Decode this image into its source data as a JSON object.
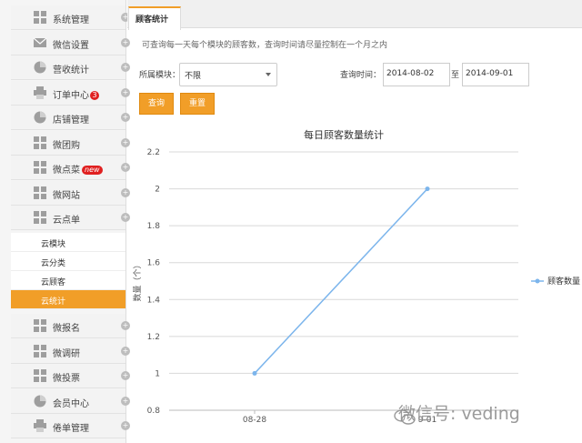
{
  "sidebar": {
    "items": [
      {
        "label": "系统管理",
        "icon": "grid-icon"
      },
      {
        "label": "微信设置",
        "icon": "envelope-icon"
      },
      {
        "label": "营收统计",
        "icon": "pie-icon"
      },
      {
        "label": "订单中心",
        "icon": "printer-icon",
        "badge": "3"
      },
      {
        "label": "店铺管理",
        "icon": "pie-icon"
      },
      {
        "label": "微团购",
        "icon": "grid-icon"
      },
      {
        "label": "微点菜",
        "icon": "grid-icon",
        "badge_new": "new"
      },
      {
        "label": "微网站",
        "icon": "grid-icon"
      },
      {
        "label": "云点单",
        "icon": "grid-icon"
      }
    ],
    "subitems": [
      "云模块",
      "云分类",
      "云顾客",
      "云统计"
    ],
    "items_bottom": [
      {
        "label": "微报名",
        "icon": "grid-icon"
      },
      {
        "label": "微调研",
        "icon": "grid-icon"
      },
      {
        "label": "微投票",
        "icon": "grid-icon"
      },
      {
        "label": "会员中心",
        "icon": "pie-icon"
      },
      {
        "label": "倦单管理",
        "icon": "printer-icon"
      }
    ],
    "expand_glyph": "+"
  },
  "tab": {
    "label": "顾客统计"
  },
  "hint": "可查询每一天每个模块的顾客数，查询时间请尽量控制在一个月之内",
  "filter": {
    "module_label": "所属模块：",
    "module_value": "不限",
    "time_label": "查询时间：",
    "date_from": "2014-08-02",
    "to_label": "至",
    "date_to": "2014-09-01",
    "query_button": "查询",
    "reset_button": "重置"
  },
  "chart_data": {
    "type": "line",
    "title": "每日顾客数量统计",
    "ylabel": "数量（个）",
    "xlabel": "",
    "categories": [
      "08-28",
      "9-01"
    ],
    "series": [
      {
        "name": "顾客数量",
        "values": [
          1,
          2
        ],
        "color": "#7cb5ec"
      }
    ],
    "ylim": [
      0.8,
      2.2
    ],
    "yticks": [
      "0.8",
      "1",
      "1.2",
      "1.4",
      "1.6",
      "1.8",
      "2",
      "2.2"
    ],
    "grid": true,
    "legend": "right"
  },
  "watermark": "微信号: veding",
  "colors": {
    "accent": "#f19e28",
    "series": "#7cb5ec",
    "badge": "#e02020"
  }
}
